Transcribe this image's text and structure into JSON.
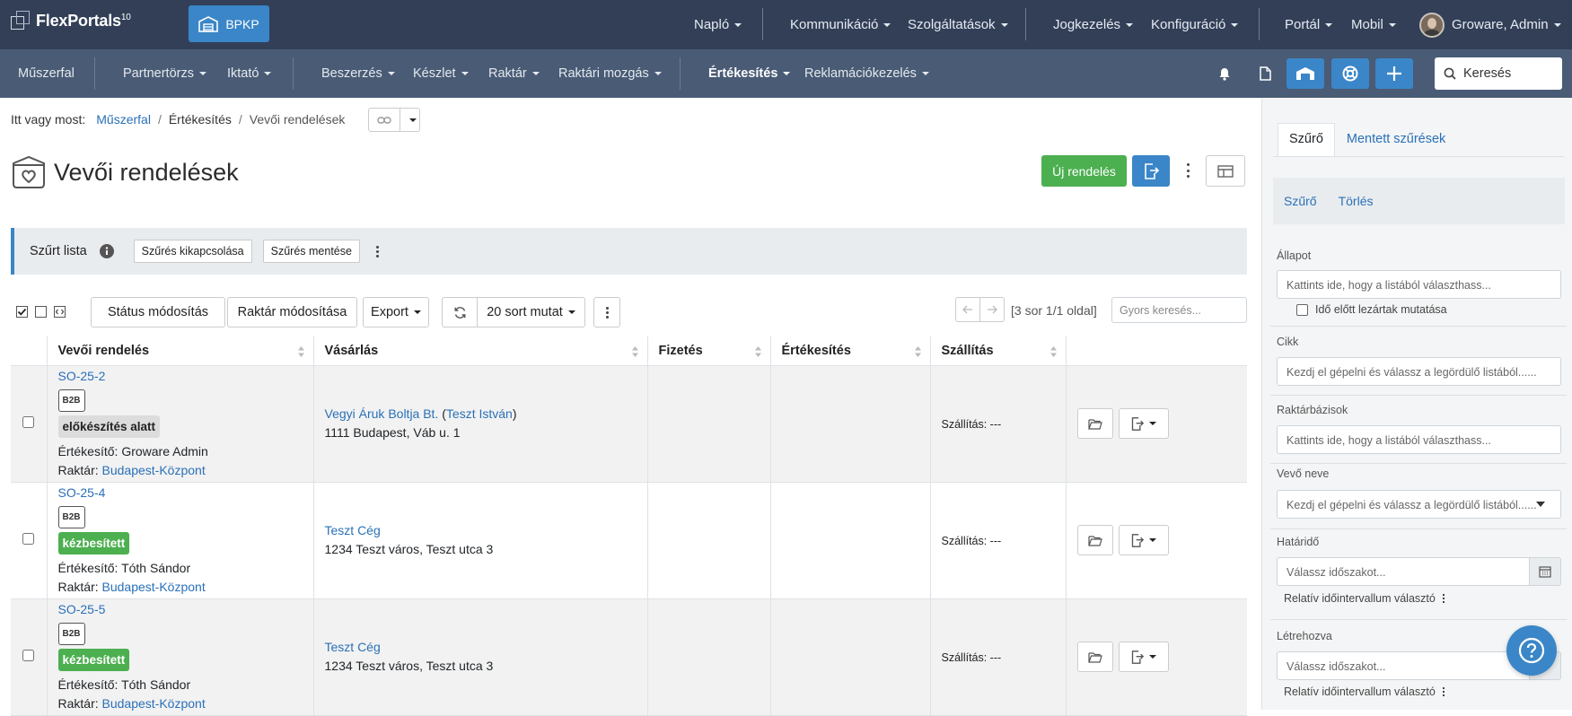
{
  "app": {
    "name": "FlexPortals",
    "version": "10",
    "company_button": "BPKP"
  },
  "top_nav": {
    "items": [
      "Napló",
      "Kommunikáció",
      "Szolgáltatások",
      "Jogkezelés",
      "Konfiguráció",
      "Portál",
      "Mobil"
    ],
    "user": "Groware, Admin"
  },
  "sub_nav": {
    "items": [
      "Műszerfal",
      "Partnertörzs",
      "Iktató",
      "Beszerzés",
      "Készlet",
      "Raktár",
      "Raktári mozgás",
      "Értékesítés",
      "Reklamációkezelés"
    ],
    "search_placeholder": "Keresés"
  },
  "breadcrumb": {
    "prefix": "Itt vagy most:",
    "items": [
      "Műszerfal",
      "Értékesítés",
      "Vevői rendelések"
    ]
  },
  "page": {
    "title": "Vevői rendelések",
    "new_button": "Új rendelés"
  },
  "filter_bar": {
    "label": "Szűrt lista",
    "disable_button": "Szűrés kikapcsolása",
    "save_button": "Szűrés mentése"
  },
  "toolbar": {
    "status_button": "Státus módosítás",
    "warehouse_button": "Raktár módosítása",
    "export_button": "Export",
    "rows_button": "20 sort mutat",
    "pager": "[3 sor 1/1 oldal]",
    "quick_search_placeholder": "Gyors keresés..."
  },
  "table": {
    "columns": [
      "Vevői rendelés",
      "Vásárlás",
      "Fizetés",
      "Értékesítés",
      "Szállítás"
    ],
    "rows": [
      {
        "id": "SO-25-2",
        "badge": "B2B",
        "status": "előkészítés alatt",
        "status_color": "#dcdcdc",
        "seller_label": "Értékesítő:",
        "seller": "Groware Admin",
        "warehouse_label": "Raktár:",
        "warehouse": "Budapest-Központ",
        "customer": "Vegyi Áruk Boltja Bt.",
        "contact": "Teszt István",
        "address": "1111 Budapest, Váb u. 1",
        "shipping": "Szállítás: ---"
      },
      {
        "id": "SO-25-4",
        "badge": "B2B",
        "status": "kézbesített",
        "status_color": "#4caf50",
        "seller_label": "Értékesítő:",
        "seller": "Tóth Sándor",
        "warehouse_label": "Raktár:",
        "warehouse": "Budapest-Központ",
        "customer": "Teszt Cég",
        "contact": "",
        "address": "1234 Teszt város, Teszt utca 3",
        "shipping": "Szállítás: ---"
      },
      {
        "id": "SO-25-5",
        "badge": "B2B",
        "status": "kézbesített",
        "status_color": "#4caf50",
        "seller_label": "Értékesítő:",
        "seller": "Tóth Sándor",
        "warehouse_label": "Raktár:",
        "warehouse": "Budapest-Központ",
        "customer": "Teszt Cég",
        "contact": "",
        "address": "1234 Teszt város, Teszt utca 3",
        "shipping": "Szállítás: ---"
      }
    ]
  },
  "sidebar": {
    "tabs": [
      "Szűrő",
      "Mentett szűrések"
    ],
    "actions": [
      "Szűrő",
      "Törlés"
    ],
    "fields": {
      "allapot_label": "Állapot",
      "allapot_placeholder": "Kattints ide, hogy a listából választhass...",
      "allapot_checkbox": "Idő előtt lezártak mutatása",
      "cikk_label": "Cikk",
      "cikk_placeholder": "Kezdj el gépelni és válassz a legördülő listából......",
      "raktar_label": "Raktárbázisok",
      "raktar_placeholder": "Kattints ide, hogy a listából választhass...",
      "vevo_label": "Vevő neve",
      "vevo_placeholder": "Kezdj el gépelni és válassz a legördülő listából......",
      "hatarido_label": "Határidő",
      "hatarido_placeholder": "Válassz időszakot...",
      "hatarido_relative": "Relatív időintervallum választó",
      "letrehozva_label": "Létrehozva",
      "letrehozva_placeholder": "Válassz időszakot...",
      "letrehozva_relative": "Relatív időintervallum választó"
    }
  },
  "colors": {
    "topbar": "#323f57",
    "subbar": "#4a5b75",
    "accent": "#3a86c8",
    "success": "#4caf50"
  }
}
